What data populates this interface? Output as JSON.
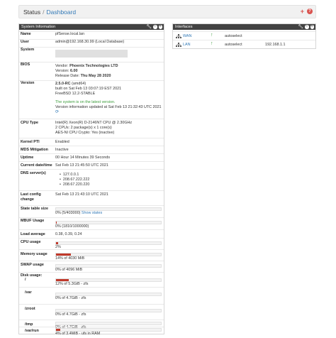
{
  "header": {
    "crumb_root": "Status",
    "crumb_sep": "/",
    "crumb_current": "Dashboard",
    "add_icon": "plus-icon",
    "help_icon": "question-icon"
  },
  "colors": {
    "accent": "#337ab7",
    "panel_heading": "#424242",
    "danger": "#d9534f",
    "success": "#3c9c3c",
    "bar_fill": "#c0392b"
  },
  "system": {
    "title": "System Information",
    "rows": {
      "name": {
        "label": "Name",
        "value": "pfSense.local.lan"
      },
      "user": {
        "label": "User",
        "value": "admin@192.168.30.99 (Local Database)"
      },
      "system": {
        "label": "System"
      },
      "bios": {
        "label": "BIOS",
        "vendor_prefix": "Vendor: ",
        "vendor": "Phoenix Technologies LTD",
        "version_prefix": "Version: ",
        "version": "6.00",
        "release_prefix": "Release Date: ",
        "release": "Thu May 28 2020"
      },
      "version": {
        "label": "Version",
        "release": "2.5.0-RC",
        "arch": " (amd64)",
        "built": "built on Sat Feb 13 03:07:19 EST 2021",
        "freebsd": "FreeBSD 12.2-STABLE",
        "latest": "The system is on the latest version.",
        "info": "Version information updated at Sat Feb 13 21:32:43 UTC 2021"
      },
      "cpu_type": {
        "label": "CPU Type",
        "model": "Intel(R) Xeon(R) D-2146NT CPU @ 2.30GHz",
        "cores": "2 CPUs: 2 package(s) x 1 core(s)",
        "aes": "AES-NI CPU Crypto: Yes (inactive)"
      },
      "kernel_pti": {
        "label": "Kernel PTI",
        "value": "Enabled"
      },
      "mds": {
        "label": "MDS Mitigation",
        "value": "Inactive"
      },
      "uptime": {
        "label": "Uptime",
        "value": "00 Hour 14 Minutes 39 Seconds"
      },
      "datetime": {
        "label": "Current date/time",
        "value": "Sat Feb 13 21:45:50 UTC 2021"
      },
      "dns": {
        "label": "DNS server(s)",
        "servers": [
          "127.0.0.1",
          "208.67.222.222",
          "208.67.220.220"
        ]
      },
      "last_config": {
        "label_1": "Last config",
        "label_2": "change",
        "value": "Sat Feb 13 21:43:10 UTC 2021"
      },
      "state_table": {
        "label": "State table size",
        "value": "0% (5/403000)",
        "link": "Show states",
        "percent": 0
      },
      "mbuf": {
        "label": "MBUF Usage",
        "value": "0% (1810/1000000)",
        "percent": 0.18
      },
      "load": {
        "label": "Load average",
        "value": "0.38, 0.39, 0.24"
      },
      "cpu_usage": {
        "label": "CPU usage",
        "value": "2%",
        "percent": 2
      },
      "memory": {
        "label": "Memory usage",
        "value": "14% of 4030 MiB",
        "percent": 14
      },
      "swap": {
        "label": "SWAP usage",
        "value": "0% of 4096 MiB",
        "percent": 0
      },
      "disk": {
        "label": "Disk usage:"
      },
      "disk_root": {
        "label": "/",
        "value": "12% of 5.3GiB - zfs",
        "percent": 12
      },
      "disk_var": {
        "label": "/var",
        "value": "0% of 4.7GiB - zfs",
        "percent": 0
      },
      "disk_zroot": {
        "label": "/zroot",
        "value": "0% of 4.7GiB - zfs",
        "percent": 0
      },
      "disk_tmp": {
        "label": "/tmp",
        "value": "0% of 4.7GiB - zfs",
        "percent": 0
      },
      "disk_varrun": {
        "label": "/var/run",
        "value": "4% of 3.4MiB - ufs in RAM",
        "percent": 4
      }
    }
  },
  "interfaces": {
    "title": "Interfaces",
    "rows": [
      {
        "name": "WAN",
        "media": "autoselect",
        "ip": ""
      },
      {
        "name": "LAN",
        "media": "autoselect",
        "ip": "192.168.1.1"
      }
    ]
  }
}
